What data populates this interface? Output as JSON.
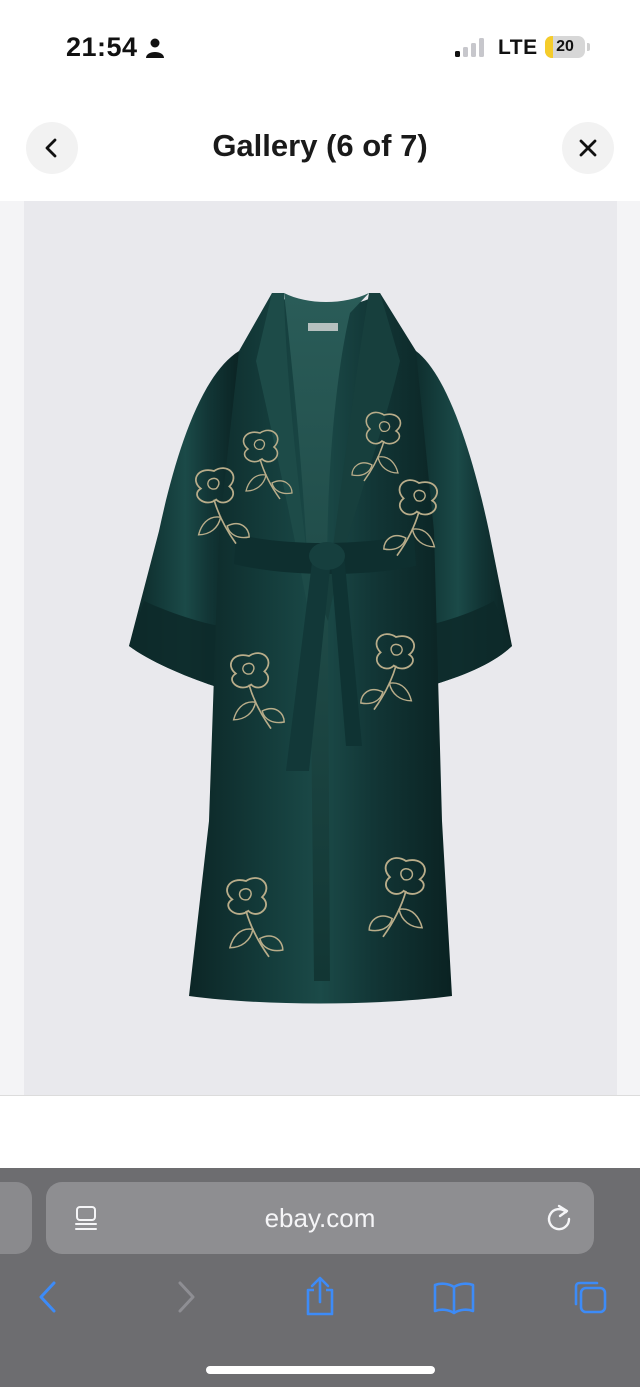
{
  "status_bar": {
    "time": "21:54",
    "network": "LTE",
    "battery_percent": "20",
    "battery_level": 0.2,
    "signal_bars_active": 1,
    "icons": [
      "person-icon",
      "signal-icon",
      "battery-icon"
    ]
  },
  "header": {
    "title": "Gallery (6 of 7)",
    "back_icon": "chevron-left-icon",
    "close_icon": "close-icon"
  },
  "gallery": {
    "current_index": 6,
    "total": 7,
    "photo_subject": "embroidered-velvet-robe",
    "colors": {
      "background": "#e9e9ed",
      "garment": "#0f3131",
      "embroidery": "#b9ad8a"
    }
  },
  "browser": {
    "url": "ebay.com",
    "icons": [
      "reader-icon",
      "reload-icon",
      "back-icon",
      "forward-icon",
      "share-icon",
      "bookmarks-icon",
      "tabs-icon"
    ],
    "accent_color": "#3d8bf7"
  }
}
